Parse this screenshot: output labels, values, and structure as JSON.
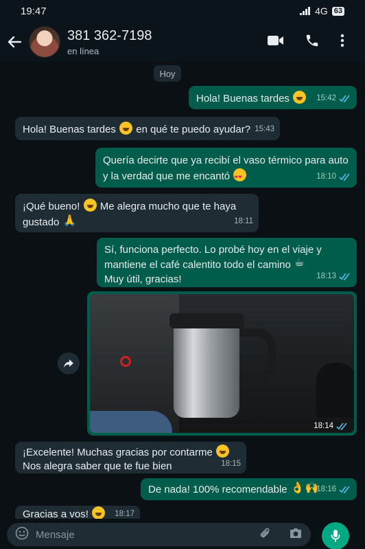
{
  "status": {
    "time": "19:47",
    "network": "4G",
    "battery": "63"
  },
  "header": {
    "contact_name": "381 362-7198",
    "contact_status": "en línea"
  },
  "chat": {
    "date_label": "Hoy",
    "messages": [
      {
        "direction": "out",
        "text": "Hola! Buenas tardes",
        "time": "15:42"
      },
      {
        "direction": "in",
        "text_a": "Hola! Buenas tardes",
        "text_b": "en qué te puedo ayudar?",
        "time": "15:43"
      },
      {
        "direction": "out",
        "line1": "Quería decirte que ya recibí el vaso térmico para auto",
        "line2": "y la verdad que me encantó",
        "time": "18:10"
      },
      {
        "direction": "in",
        "line1a": "¡Qué bueno!",
        "line1b": "Me alegra mucho que te haya",
        "line2": "gustado",
        "time": "18:11"
      },
      {
        "direction": "out",
        "line1": "Sí, funciona perfecto. Lo probé hoy en el viaje y",
        "line2": "mantiene el café calentito todo el camino",
        "line3": "Muy útil, gracias!",
        "time": "18:13"
      },
      {
        "direction": "out",
        "type": "image",
        "time": "18:14"
      },
      {
        "direction": "in",
        "line1": "¡Excelente! Muchas gracias por contarme",
        "line2": "Nos alegra saber que te fue bien",
        "time": "18:15"
      },
      {
        "direction": "out",
        "text": "De nada! 100% recomendable",
        "time": "18:16"
      },
      {
        "direction": "in",
        "text": "Gracias a vos!",
        "time": "18:17"
      }
    ]
  },
  "composer": {
    "placeholder": "Mensaje"
  },
  "icons": {
    "back": "arrow-left-icon",
    "video": "video-call-icon",
    "call": "phone-icon",
    "menu": "more-vert-icon",
    "emoji": "emoji-icon",
    "attach": "attach-icon",
    "camera": "camera-icon",
    "mic": "mic-icon",
    "forward": "forward-icon"
  },
  "colors": {
    "incoming_bubble": "#1f2c34",
    "outgoing_bubble": "#005c4b",
    "read_ticks": "#53bdeb",
    "accent": "#00a884",
    "background": "#0b1014"
  }
}
